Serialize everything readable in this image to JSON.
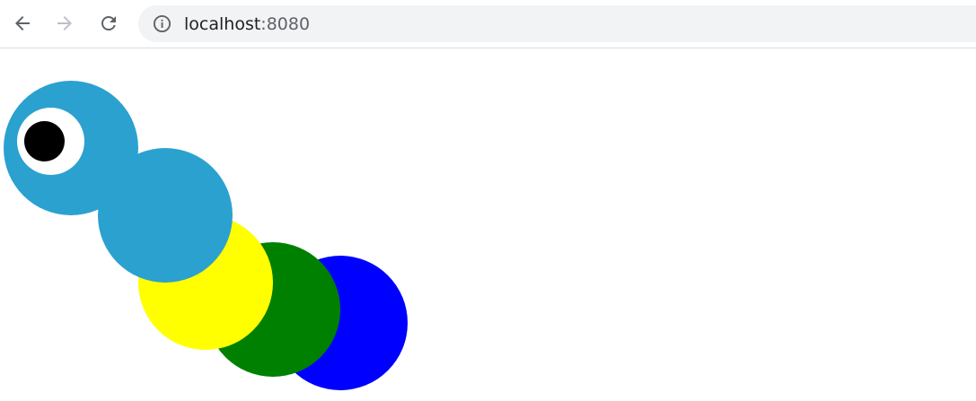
{
  "browser": {
    "url_host": "localhost",
    "url_port": ":8080",
    "icons": {
      "back": "arrow-left-icon",
      "forward": "arrow-right-icon",
      "reload": "reload-icon",
      "info": "info-icon"
    }
  },
  "caterpillar": {
    "segment_colors": [
      "#2ba1d0",
      "#2ba1d0",
      "#ffff00",
      "#008000",
      "#0000ff"
    ],
    "eye_white": "#ffffff",
    "pupil": "#000000"
  }
}
